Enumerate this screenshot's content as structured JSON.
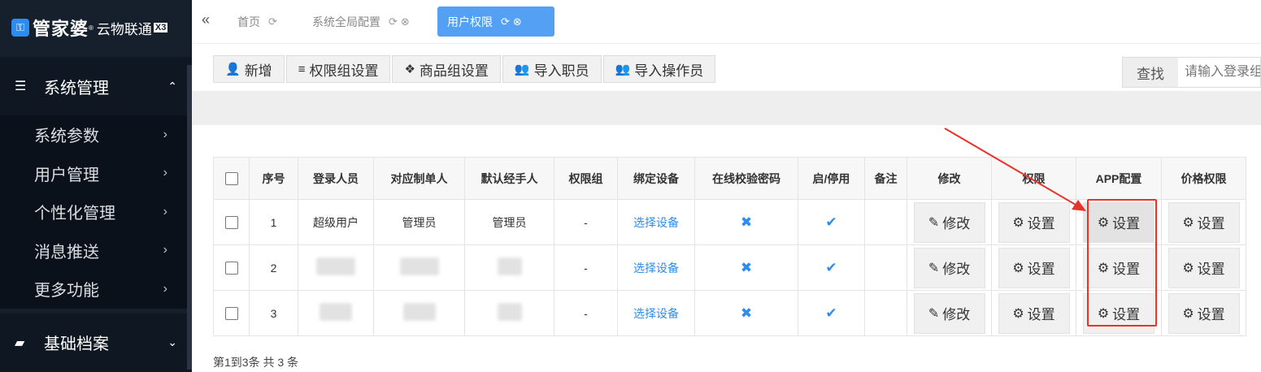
{
  "logo": {
    "main": "管家婆",
    "sub": "云物联通",
    "edition": "X3",
    "reg": "®"
  },
  "sidebar": {
    "groups": [
      {
        "label": "系统管理",
        "icon": "sliders-icon",
        "expanded": true
      },
      {
        "label": "基础档案",
        "icon": "folder-open-icon",
        "expanded": false
      }
    ],
    "sub_items": [
      {
        "label": "系统参数"
      },
      {
        "label": "用户管理"
      },
      {
        "label": "个性化管理"
      },
      {
        "label": "消息推送"
      },
      {
        "label": "更多功能"
      }
    ]
  },
  "tabs": [
    {
      "label": "首页",
      "active": false,
      "icons": [
        "refresh-icon"
      ]
    },
    {
      "label": "系统全局配置",
      "active": false,
      "icons": [
        "refresh-icon",
        "close-icon"
      ]
    },
    {
      "label": "用户权限",
      "active": true,
      "icons": [
        "refresh-icon",
        "close-icon"
      ]
    }
  ],
  "toolbar": {
    "buttons": [
      {
        "label": "新增",
        "icon": "user-plus-icon"
      },
      {
        "label": "权限组设置",
        "icon": "list-icon"
      },
      {
        "label": "商品组设置",
        "icon": "cubes-icon"
      },
      {
        "label": "导入职员",
        "icon": "users-icon"
      },
      {
        "label": "导入操作员",
        "icon": "users-icon"
      }
    ]
  },
  "search": {
    "label": "查找",
    "placeholder": "请输入登录组"
  },
  "table": {
    "headers": [
      "",
      "序号",
      "登录人员",
      "对应制单人",
      "默认经手人",
      "权限组",
      "绑定设备",
      "在线校验密码",
      "启/停用",
      "备注",
      "修改",
      "权限",
      "APP配置",
      "价格权限"
    ],
    "rows": [
      {
        "index": "1",
        "login": "超级用户",
        "maker": "管理员",
        "handler": "管理员",
        "group": "-",
        "device": "选择设备",
        "online_check": false,
        "enabled": true,
        "remark": "",
        "edit": "修改",
        "perm": "设置",
        "app": "设置",
        "price": "设置"
      },
      {
        "index": "2",
        "login": "",
        "maker": "",
        "handler": "",
        "group": "-",
        "device": "选择设备",
        "online_check": false,
        "enabled": true,
        "remark": "",
        "edit": "修改",
        "perm": "设置",
        "app": "设置",
        "price": "设置"
      },
      {
        "index": "3",
        "login": "",
        "maker": "",
        "handler": "",
        "group": "-",
        "device": "选择设备",
        "online_check": false,
        "enabled": true,
        "remark": "",
        "edit": "修改",
        "perm": "设置",
        "app": "设置",
        "price": "设置"
      }
    ]
  },
  "footer": {
    "info": "第1到3条 共 3 条"
  },
  "colors": {
    "sidebar_bg": "#16202d",
    "accent": "#54a0f5",
    "link": "#2d8cf0",
    "annotation": "#e8332a"
  }
}
